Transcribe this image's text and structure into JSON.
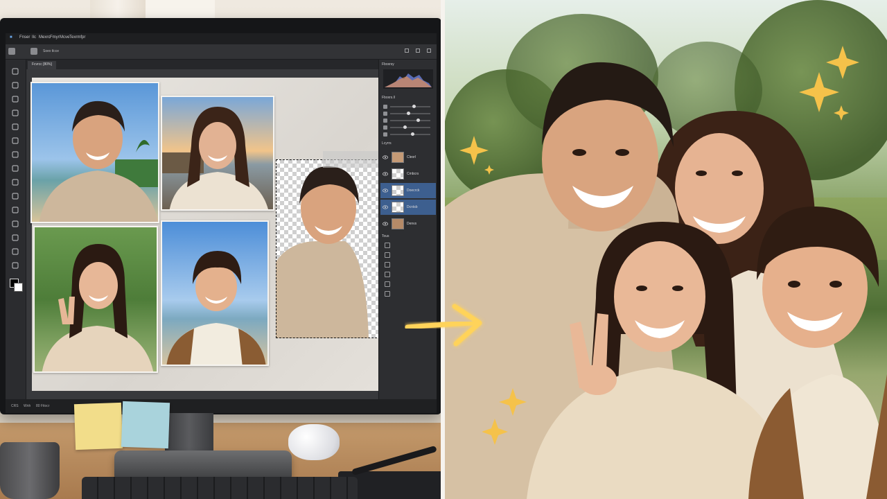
{
  "editor": {
    "menu_items": [
      "Fnser",
      "Ilc",
      "Mexrc",
      "Fmyr",
      "Mcve",
      "Tiser",
      "Texrmfpr"
    ],
    "option_bar_label": "Soex tlcce",
    "document_tab": "Fcvrcc [80%]",
    "status_left": "CRS",
    "status_mid": "Wnh",
    "status_right": "80 Fitocr",
    "tools": [
      "move-icon",
      "marquee-icon",
      "crop-icon",
      "lasso-icon",
      "brush-icon",
      "pen-icon",
      "eraser-icon",
      "clone-stamp-icon",
      "gradient-icon",
      "dodge-icon",
      "eyedropper-icon",
      "shape-icon",
      "text-icon",
      "hand-icon",
      "zoom-icon"
    ],
    "panels": {
      "histogram_title": "Fboxrsy",
      "adjustments_title": "Fboxrs.ll",
      "adjustment_levels": [
        0.6,
        0.45,
        0.7,
        0.35,
        0.55
      ],
      "layers_title": "Lcyrrs",
      "layers": [
        {
          "name": "Cleorl",
          "selected": false
        },
        {
          "name": "Cmbcrs",
          "selected": false
        },
        {
          "name": "Doecrck",
          "selected": true
        },
        {
          "name": "Dcntsb",
          "selected": true
        },
        {
          "name": "Denvs",
          "selected": false
        }
      ],
      "actions_title": "Tous"
    },
    "accent_color": "#3d5f8f",
    "selection_color": "#111111"
  },
  "photos": [
    {
      "name": "father-photo",
      "scene": "beach-sky"
    },
    {
      "name": "mother-photo",
      "scene": "sunset-pier"
    },
    {
      "name": "daughter-photo",
      "scene": "park"
    },
    {
      "name": "son-photo",
      "scene": "sea-sky"
    },
    {
      "name": "father-cutout",
      "scene": "transparent"
    }
  ],
  "result": {
    "description_people": [
      "father",
      "mother",
      "daughter",
      "son"
    ],
    "sparkle_color": "#f5c24a",
    "arrow_color": "#ffd35a"
  }
}
